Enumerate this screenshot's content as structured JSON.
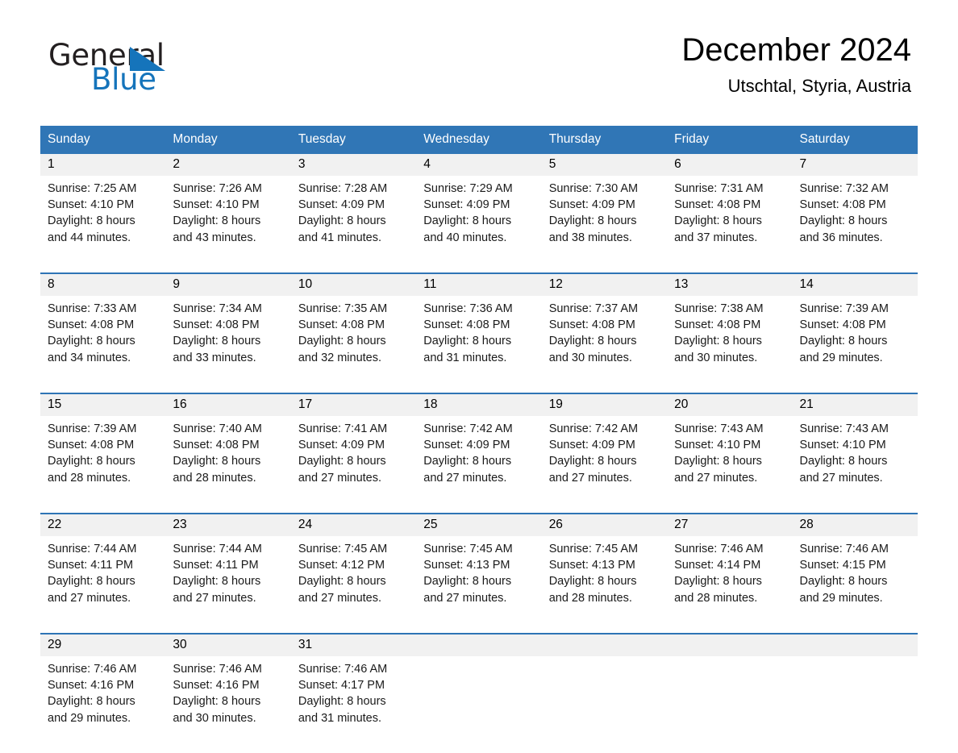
{
  "brand": {
    "word_one": "General",
    "word_two": "Blue",
    "triangle_icon": "brand-triangle-icon",
    "accent_color": "#1574bb"
  },
  "header": {
    "title": "December 2024",
    "subtitle": "Utschtal, Styria, Austria"
  },
  "theme": {
    "header_blue": "#3076b6",
    "rule_blue": "#2e74b5",
    "daynum_gray": "#f1f1f1"
  },
  "calendar": {
    "weekday_headers": [
      "Sunday",
      "Monday",
      "Tuesday",
      "Wednesday",
      "Thursday",
      "Friday",
      "Saturday"
    ],
    "weeks": [
      {
        "daynums": [
          "1",
          "2",
          "3",
          "4",
          "5",
          "6",
          "7"
        ],
        "cells": [
          "Sunrise: 7:25 AM\nSunset: 4:10 PM\nDaylight: 8 hours\nand 44 minutes.",
          "Sunrise: 7:26 AM\nSunset: 4:10 PM\nDaylight: 8 hours\nand 43 minutes.",
          "Sunrise: 7:28 AM\nSunset: 4:09 PM\nDaylight: 8 hours\nand 41 minutes.",
          "Sunrise: 7:29 AM\nSunset: 4:09 PM\nDaylight: 8 hours\nand 40 minutes.",
          "Sunrise: 7:30 AM\nSunset: 4:09 PM\nDaylight: 8 hours\nand 38 minutes.",
          "Sunrise: 7:31 AM\nSunset: 4:08 PM\nDaylight: 8 hours\nand 37 minutes.",
          "Sunrise: 7:32 AM\nSunset: 4:08 PM\nDaylight: 8 hours\nand 36 minutes."
        ]
      },
      {
        "daynums": [
          "8",
          "9",
          "10",
          "11",
          "12",
          "13",
          "14"
        ],
        "cells": [
          "Sunrise: 7:33 AM\nSunset: 4:08 PM\nDaylight: 8 hours\nand 34 minutes.",
          "Sunrise: 7:34 AM\nSunset: 4:08 PM\nDaylight: 8 hours\nand 33 minutes.",
          "Sunrise: 7:35 AM\nSunset: 4:08 PM\nDaylight: 8 hours\nand 32 minutes.",
          "Sunrise: 7:36 AM\nSunset: 4:08 PM\nDaylight: 8 hours\nand 31 minutes.",
          "Sunrise: 7:37 AM\nSunset: 4:08 PM\nDaylight: 8 hours\nand 30 minutes.",
          "Sunrise: 7:38 AM\nSunset: 4:08 PM\nDaylight: 8 hours\nand 30 minutes.",
          "Sunrise: 7:39 AM\nSunset: 4:08 PM\nDaylight: 8 hours\nand 29 minutes."
        ]
      },
      {
        "daynums": [
          "15",
          "16",
          "17",
          "18",
          "19",
          "20",
          "21"
        ],
        "cells": [
          "Sunrise: 7:39 AM\nSunset: 4:08 PM\nDaylight: 8 hours\nand 28 minutes.",
          "Sunrise: 7:40 AM\nSunset: 4:08 PM\nDaylight: 8 hours\nand 28 minutes.",
          "Sunrise: 7:41 AM\nSunset: 4:09 PM\nDaylight: 8 hours\nand 27 minutes.",
          "Sunrise: 7:42 AM\nSunset: 4:09 PM\nDaylight: 8 hours\nand 27 minutes.",
          "Sunrise: 7:42 AM\nSunset: 4:09 PM\nDaylight: 8 hours\nand 27 minutes.",
          "Sunrise: 7:43 AM\nSunset: 4:10 PM\nDaylight: 8 hours\nand 27 minutes.",
          "Sunrise: 7:43 AM\nSunset: 4:10 PM\nDaylight: 8 hours\nand 27 minutes."
        ]
      },
      {
        "daynums": [
          "22",
          "23",
          "24",
          "25",
          "26",
          "27",
          "28"
        ],
        "cells": [
          "Sunrise: 7:44 AM\nSunset: 4:11 PM\nDaylight: 8 hours\nand 27 minutes.",
          "Sunrise: 7:44 AM\nSunset: 4:11 PM\nDaylight: 8 hours\nand 27 minutes.",
          "Sunrise: 7:45 AM\nSunset: 4:12 PM\nDaylight: 8 hours\nand 27 minutes.",
          "Sunrise: 7:45 AM\nSunset: 4:13 PM\nDaylight: 8 hours\nand 27 minutes.",
          "Sunrise: 7:45 AM\nSunset: 4:13 PM\nDaylight: 8 hours\nand 28 minutes.",
          "Sunrise: 7:46 AM\nSunset: 4:14 PM\nDaylight: 8 hours\nand 28 minutes.",
          "Sunrise: 7:46 AM\nSunset: 4:15 PM\nDaylight: 8 hours\nand 29 minutes."
        ]
      },
      {
        "daynums": [
          "29",
          "30",
          "31",
          "",
          "",
          "",
          ""
        ],
        "cells": [
          "Sunrise: 7:46 AM\nSunset: 4:16 PM\nDaylight: 8 hours\nand 29 minutes.",
          "Sunrise: 7:46 AM\nSunset: 4:16 PM\nDaylight: 8 hours\nand 30 minutes.",
          "Sunrise: 7:46 AM\nSunset: 4:17 PM\nDaylight: 8 hours\nand 31 minutes.",
          "",
          "",
          "",
          ""
        ]
      }
    ]
  }
}
